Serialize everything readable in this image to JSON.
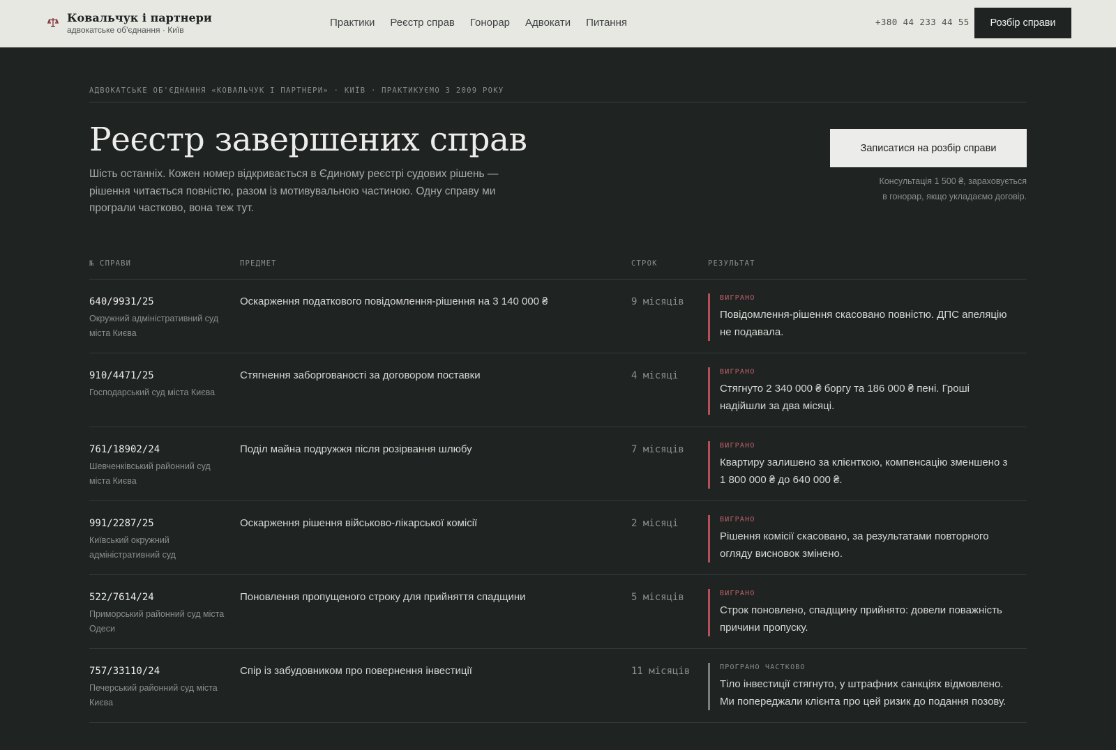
{
  "header": {
    "brand_name": "Ковальчук і партнери",
    "brand_sub": "адвокатське об'єднання · Київ",
    "brand_icon": "scales-icon",
    "nav": [
      "Практики",
      "Реєстр справ",
      "Гонорар",
      "Адвокати",
      "Питання"
    ],
    "phone": "+380 44 233 44 55",
    "cta": "Розбір справи"
  },
  "hero": {
    "eyebrow": "АДВОКАТСЬКЕ ОБ'ЄДНАННЯ «КОВАЛЬЧУК І ПАРТНЕРИ» · КИЇВ · ПРАКТИКУЄМО З 2009 РОКУ",
    "title": "Реєстр завершених справ",
    "lede": "Шість останніх. Кожен номер відкривається в Єдиному реєстрі судових рішень — рішення читається повністю, разом із мотивувальною частиною. Одну справу ми програли частково, вона теж тут.",
    "cta": "Записатися на розбір справи",
    "cta_note": "Консультація 1 500 ₴, зараховується в гонорар, якщо укладаємо договір."
  },
  "table": {
    "headers": [
      "№ СПРАВИ",
      "ПРЕДМЕТ",
      "СТРОК",
      "РЕЗУЛЬТАТ"
    ],
    "rows": [
      {
        "case_no": "640/9931/25",
        "court": "Окружний адміністративний суд міста Києва",
        "subject": "Оскарження податкового повідомлення-рішення на 3 140 000 ₴",
        "term": "9 місяців",
        "status": "ВИГРАНО",
        "result": "Повідомлення-рішення скасовано повністю. ДПС апеляцію не подавала."
      },
      {
        "case_no": "910/4471/25",
        "court": "Господарський суд міста Києва",
        "subject": "Стягнення заборгованості за договором поставки",
        "term": "4 місяці",
        "status": "ВИГРАНО",
        "result": "Стягнуто 2 340 000 ₴ боргу та 186 000 ₴ пені. Гроші надійшли за два місяці."
      },
      {
        "case_no": "761/18902/24",
        "court": "Шевченківський районний суд міста Києва",
        "subject": "Поділ майна подружжя після розірвання шлюбу",
        "term": "7 місяців",
        "status": "ВИГРАНО",
        "result": "Квартиру залишено за клієнткою, компенсацію зменшено з 1 800 000 ₴ до 640 000 ₴."
      },
      {
        "case_no": "991/2287/25",
        "court": "Київський окружний адміністративний суд",
        "subject": "Оскарження рішення військово-лікарської комісії",
        "term": "2 місяці",
        "status": "ВИГРАНО",
        "result": "Рішення комісії скасовано, за результатами повторного огляду висновок змінено."
      },
      {
        "case_no": "522/7614/24",
        "court": "Приморський районний суд міста Одеси",
        "subject": "Поновлення пропущеного строку для прийняття спадщини",
        "term": "5 місяців",
        "status": "ВИГРАНО",
        "result": "Строк поновлено, спадщину прийнято: довели поважність причини пропуску."
      },
      {
        "case_no": "757/33110/24",
        "court": "Печерський районний суд міста Києва",
        "subject": "Спір із забудовником про повернення інвестиції",
        "term": "11 місяців",
        "status": "ПРОГРАНО ЧАСТКОВО",
        "result": "Тіло інвестиції стягнуто, у штрафних санкціях відмовлено. Ми попереджали клієнта про цей ризик до подання позову."
      }
    ]
  },
  "colors": {
    "accent_won": "#b5505b",
    "accent_partial": "#7a7f7c",
    "bg": "#1f2322",
    "header_bg": "#e8e8e3"
  }
}
